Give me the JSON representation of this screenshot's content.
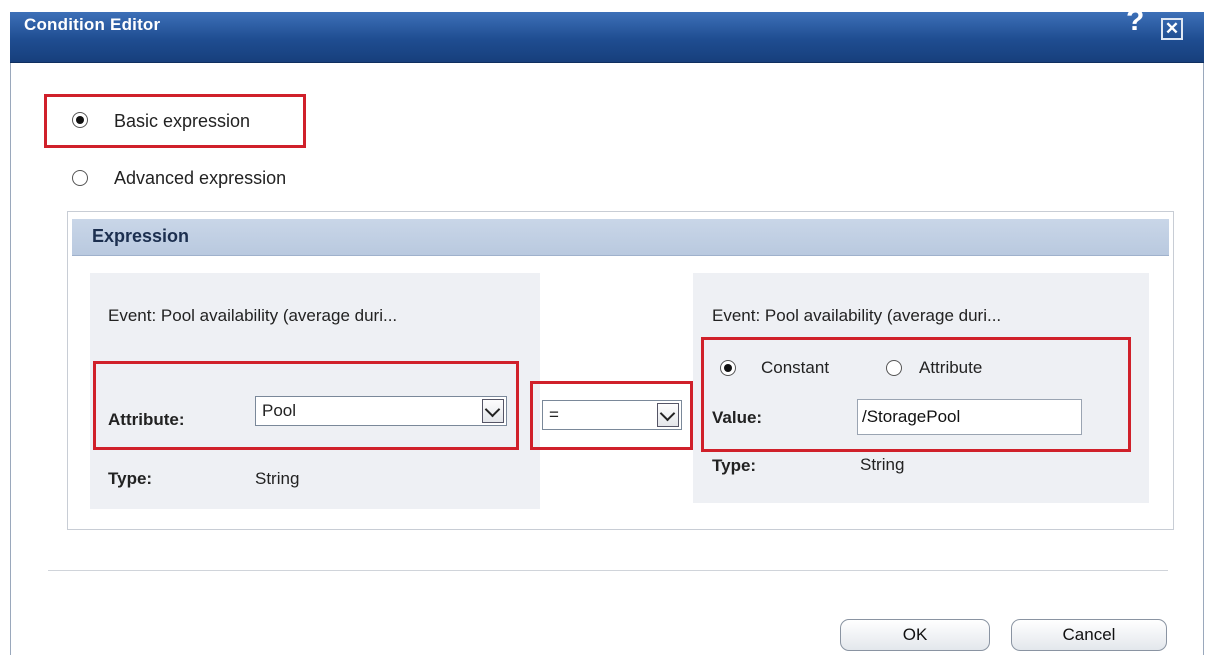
{
  "dialog": {
    "title": "Condition Editor",
    "help_icon": "?",
    "close_icon": "✕"
  },
  "mode": {
    "basic_label": "Basic expression",
    "advanced_label": "Advanced expression",
    "selected": "basic"
  },
  "expression": {
    "header": "Expression",
    "left": {
      "event_text": "Event:  Pool availability (average duri...",
      "attribute_label": "Attribute:",
      "attribute_value": "Pool",
      "type_label": "Type:",
      "type_value": "String"
    },
    "operator": {
      "value": "="
    },
    "right": {
      "event_text": "Event:  Pool availability (average duri...",
      "constant_label": "Constant",
      "attribute_label": "Attribute",
      "selected": "constant",
      "value_label": "Value:",
      "value": "/StoragePool",
      "type_label": "Type:",
      "type_value": "String"
    }
  },
  "footer": {
    "ok_label": "OK",
    "cancel_label": "Cancel"
  },
  "colors": {
    "title_bar": "#1f4d91",
    "highlight_box": "#d0202a",
    "section_header": "#c9d6e8",
    "panel": "#eef0f4"
  }
}
